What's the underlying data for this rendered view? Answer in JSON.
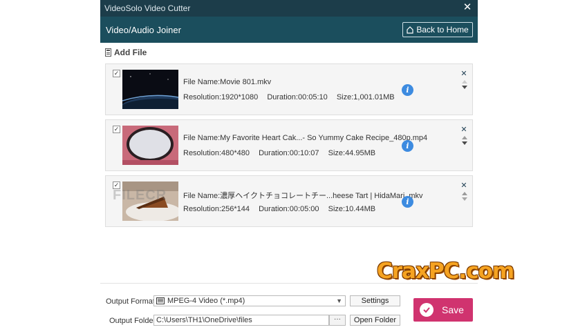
{
  "app_title": "VideoSolo Video Cutter",
  "header": {
    "title": "Video/Audio Joiner",
    "back_label": "Back to Home"
  },
  "add_file_label": "Add File",
  "files": [
    {
      "name": "File Name:Movie 801.mkv",
      "resolution": "Resolution:1920*1080",
      "duration": "Duration:00:05:10",
      "size": "Size:1,001.01MB",
      "checked": true
    },
    {
      "name": "File Name:My Favorite Heart Cak...- So Yummy Cake Recipe_480p.mp4",
      "resolution": "Resolution:480*480",
      "duration": "Duration:00:10:07",
      "size": "Size:44.95MB",
      "checked": true
    },
    {
      "name": "File Name:濃厚ヘイクトチョコレートチー...heese Tart | HidaMari .mkv",
      "resolution": "Resolution:256*144",
      "duration": "Duration:00:05:00",
      "size": "Size:10.44MB",
      "checked": true
    }
  ],
  "output": {
    "format_label": "Output Format:",
    "format_value": "MPEG-4 Video (*.mp4)",
    "settings_label": "Settings",
    "folder_label": "Output Folder:",
    "folder_value": "C:\\Users\\TH1\\OneDrive\\files",
    "browse_label": "···",
    "open_folder_label": "Open Folder"
  },
  "save_label": "Save",
  "watermark": "CraxPC.com",
  "thumb_watermark": "FILECR",
  "colors": {
    "titlebar": "#1c3d4a",
    "header": "#1b4e5d",
    "save": "#d0336f",
    "info": "#3d8be0"
  }
}
